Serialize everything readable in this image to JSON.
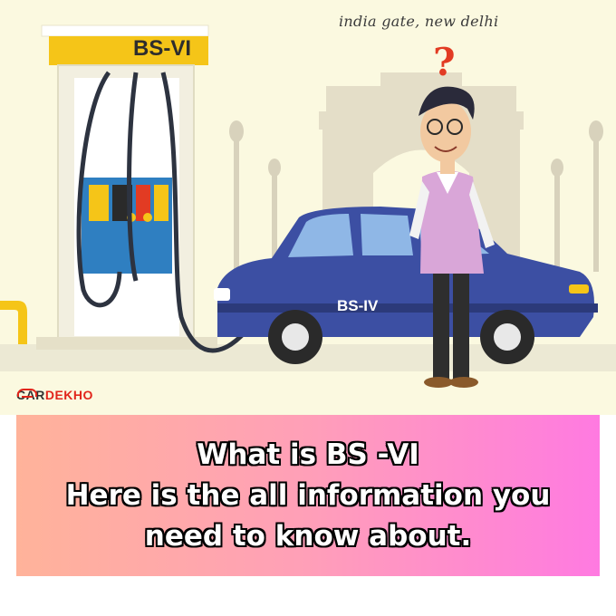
{
  "scene": {
    "location_caption": "india gate, new delhi",
    "pump_label": "BS-VI",
    "car_label": "BS-IV",
    "question_mark": "?",
    "brand": {
      "prefix": "CAR",
      "accent": "DEKHO",
      "icon": "car-outline-icon"
    },
    "colors": {
      "background": "#fbf9e0",
      "pump_yellow": "#f5c518",
      "car_blue": "#3c4fa3",
      "sweater": "#d9a6d8",
      "monument": "#e2dcc4"
    }
  },
  "banner": {
    "lines": [
      "What is BS -VI",
      "Here is the all information you",
      "need to know about."
    ],
    "gradient": [
      "#ffb39a",
      "#ff9fb8",
      "#ff7ae1"
    ]
  }
}
